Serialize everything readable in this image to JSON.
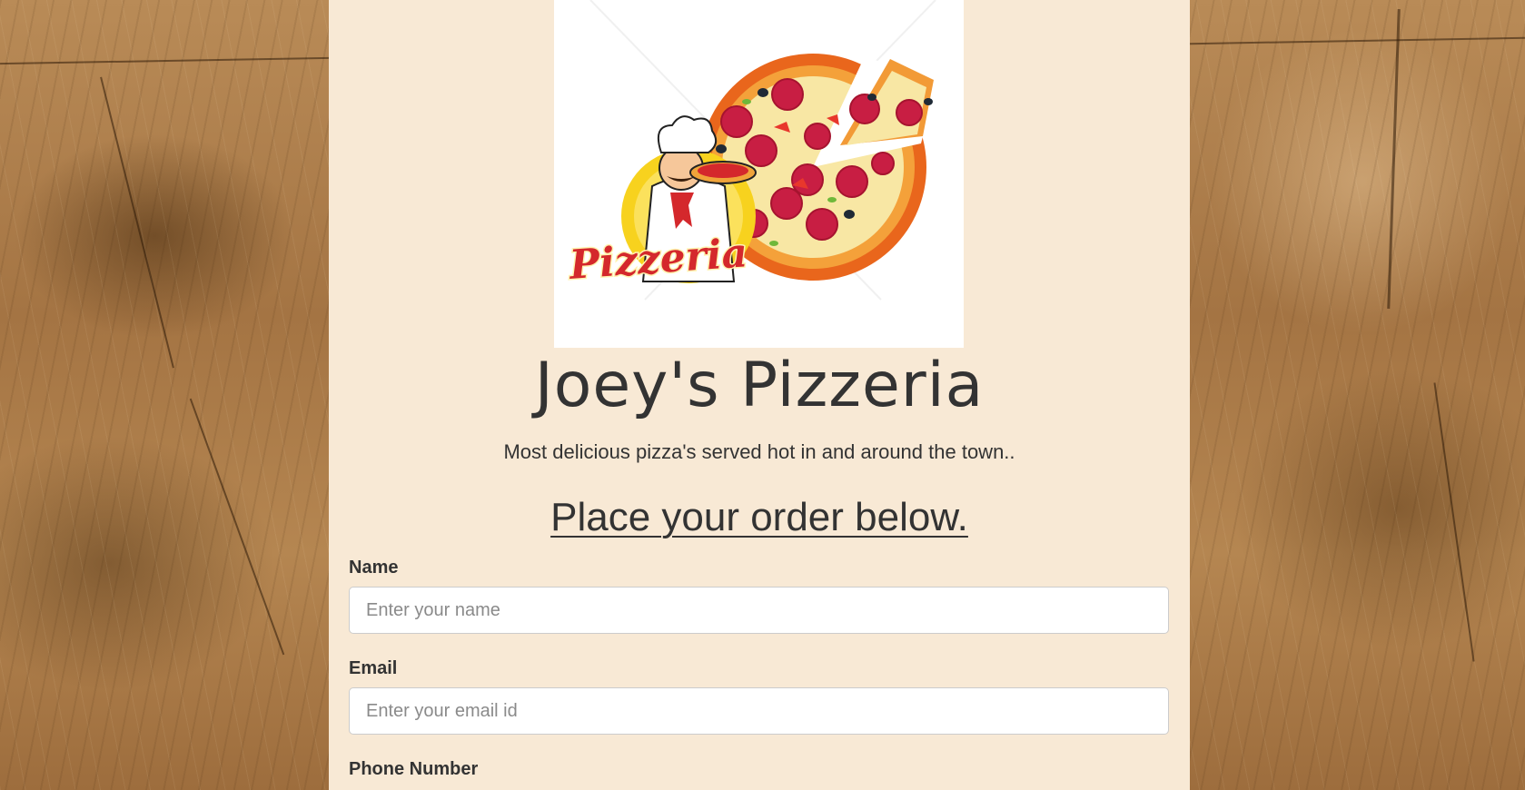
{
  "brand": {
    "logo_text": "Pizzeria",
    "title": "Joey's Pizzeria",
    "tagline": "Most delicious pizza's served hot in and around the town.."
  },
  "order_form": {
    "heading": "Place your order below.",
    "fields": [
      {
        "label": "Name",
        "placeholder": "Enter your name",
        "value": ""
      },
      {
        "label": "Email",
        "placeholder": "Enter your email id",
        "value": ""
      },
      {
        "label": "Phone Number",
        "placeholder": "",
        "value": ""
      }
    ]
  },
  "colors": {
    "page_panel": "#f8e9d5",
    "text": "#333333",
    "wood_background": "#a87a47",
    "logo_red": "#d4282c",
    "logo_yellow": "#f7d21e"
  }
}
